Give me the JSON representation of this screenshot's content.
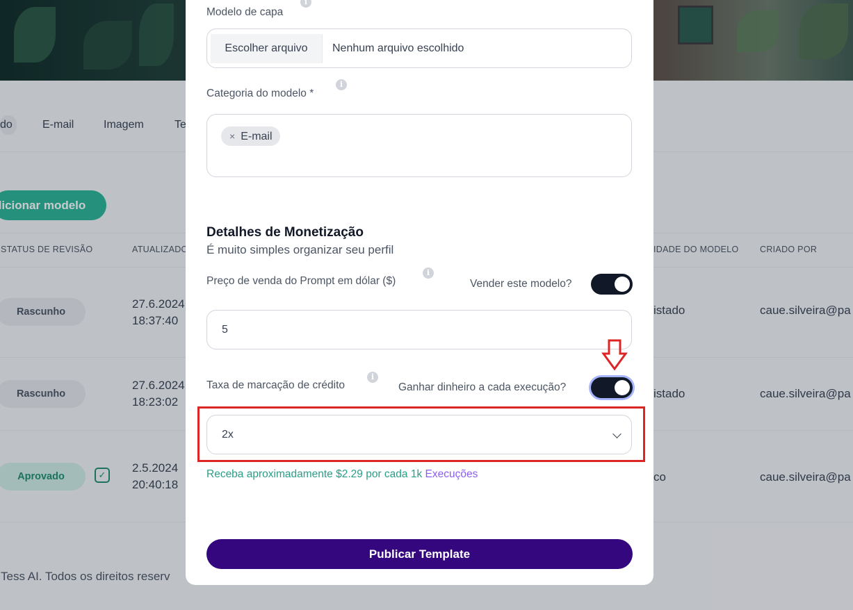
{
  "background": {
    "tabs": [
      "do",
      "E-mail",
      "Imagem",
      "Te"
    ],
    "add_button": "dicionar modelo",
    "columns": {
      "status": "STATUS DE REVISÃO",
      "updated": "ATUALIZADO",
      "visibility": "IDADE DO MODELO",
      "created_by": "CRIADO POR"
    },
    "rows": [
      {
        "status": "Rascunho",
        "date": "27.6.2024",
        "time": "18:37:40",
        "visibility": "istado",
        "creator": "caue.silveira@pa"
      },
      {
        "status": "Rascunho",
        "date": "27.6.2024",
        "time": "18:23:02",
        "visibility": "istado",
        "creator": "caue.silveira@pa"
      },
      {
        "status": "Aprovado",
        "date": "2.5.2024",
        "time": "20:40:18",
        "visibility": "co",
        "creator": "caue.silveira@pa",
        "check": "✓"
      }
    ],
    "footer": "Tess AI. Todos os direitos reserv"
  },
  "modal": {
    "cover_label": "Modelo de capa",
    "file_button": "Escolher arquivo",
    "file_status": "Nenhum arquivo escolhido",
    "category_label": "Categoria do modelo *",
    "category_chip": "E-mail",
    "chip_remove": "×",
    "info_glyph": "i",
    "section_title": "Detalhes de Monetização",
    "section_subtitle": "É muito simples organizar seu perfil",
    "price_label": "Preço de venda do Prompt em dólar ($)",
    "sell_label": "Vender este modelo?",
    "sell_toggle_on": true,
    "price_value": "5",
    "markup_label": "Taxa de marcação de crédito",
    "earn_label": "Ganhar dinheiro a cada execução?",
    "earn_toggle_on": true,
    "markup_value": "2x",
    "earn_text_a": "Receba aproximadamente $2.29 por cada 1k",
    "earn_text_b": " Execuções",
    "publish_button": "Publicar Template"
  },
  "annotation_color": "#dc2626"
}
